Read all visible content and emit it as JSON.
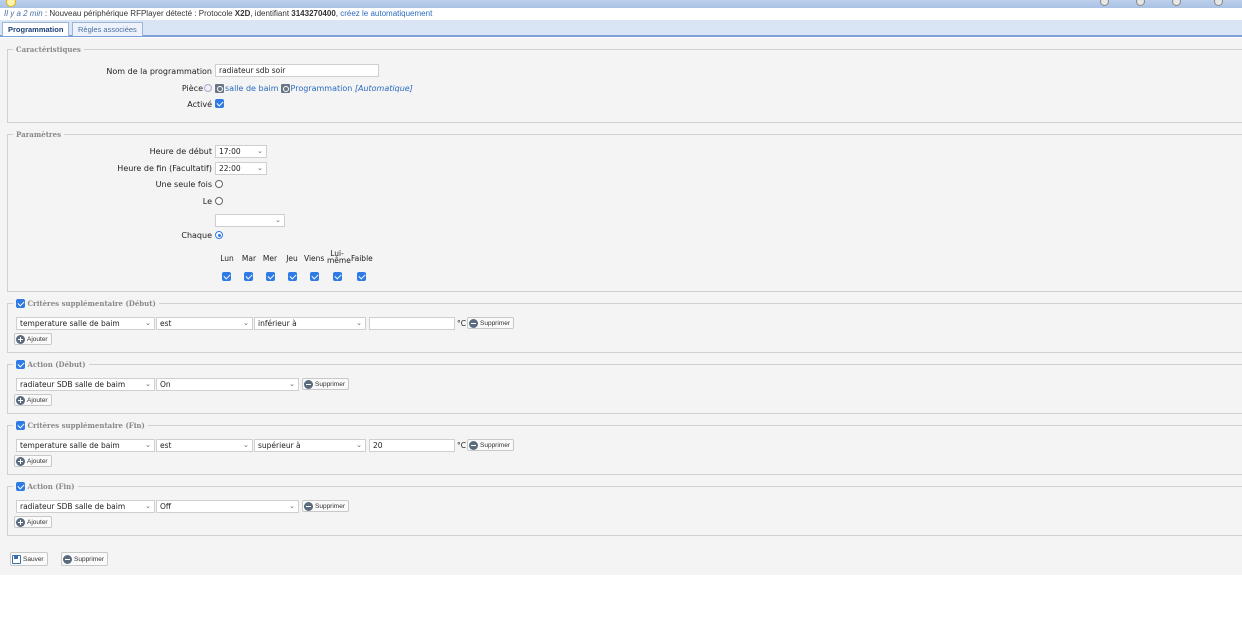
{
  "notification": {
    "time": "Il y a 2 min",
    "text_before": " : Nouveau périphérique RFPlayer détecté : Protocole ",
    "protocol": "X2D",
    "text_mid": ", identifiant ",
    "identifier": "3143270400",
    "text_sep": ", ",
    "link": "créez le automatiquement"
  },
  "tabs": [
    "Programmation",
    "Règles associées"
  ],
  "characteristics": {
    "legend": "Caractéristiques",
    "name_label": "Nom de la programmation",
    "name_value": "radiateur sdb soir",
    "room_label": "Pièce",
    "room_value": "salle de baim",
    "room_extra": "Programmation",
    "room_extra_tag": "[Automatique]",
    "active_label": "Activé",
    "active_checked": true
  },
  "parameters": {
    "legend": "Paramètres",
    "start_label": "Heure de début",
    "start_value": "17:00",
    "end_label": "Heure de fin (Facultatif)",
    "end_value": "22:00",
    "once_label": "Une seule fois",
    "on_label": "Le",
    "on_value": "",
    "each_label": "Chaque",
    "selected_mode": "Chaque",
    "days": [
      {
        "label": "Lun",
        "checked": true
      },
      {
        "label": "Mar",
        "checked": true
      },
      {
        "label": "Mer",
        "checked": true
      },
      {
        "label": "Jeu",
        "checked": true
      },
      {
        "label": "Viens",
        "checked": true
      },
      {
        "label": "Lui-même",
        "checked": true
      },
      {
        "label": "Faible",
        "checked": true
      }
    ]
  },
  "criteria_start": {
    "legend": "Critères supplémentaire (Début)",
    "enabled": true,
    "device": "temperature salle de baim",
    "operator": "est",
    "comparison": "inférieur à",
    "value": "",
    "unit": "°C",
    "delete_label": "Supprimer",
    "add_label": "Ajouter"
  },
  "action_start": {
    "legend": "Action (Début)",
    "enabled": true,
    "device": "radiateur SDB salle de baim",
    "value": "On",
    "delete_label": "Supprimer",
    "add_label": "Ajouter"
  },
  "criteria_end": {
    "legend": "Critères supplémentaire (Fin)",
    "enabled": true,
    "device": "temperature salle de baim",
    "operator": "est",
    "comparison": "supérieur à",
    "value": "20",
    "unit": "°C",
    "delete_label": "Supprimer",
    "add_label": "Ajouter"
  },
  "action_end": {
    "legend": "Action (Fin)",
    "enabled": true,
    "device": "radiateur SDB salle de baim",
    "value": "Off",
    "delete_label": "Supprimer",
    "add_label": "Ajouter"
  },
  "footer": {
    "save_label": "Sauver",
    "delete_label": "Supprimer"
  },
  "colors": {
    "accent": "#2f7be5",
    "link": "#2a6bbf",
    "tab_bar": "#d9e5f5",
    "panel": "#f4f4f4"
  }
}
